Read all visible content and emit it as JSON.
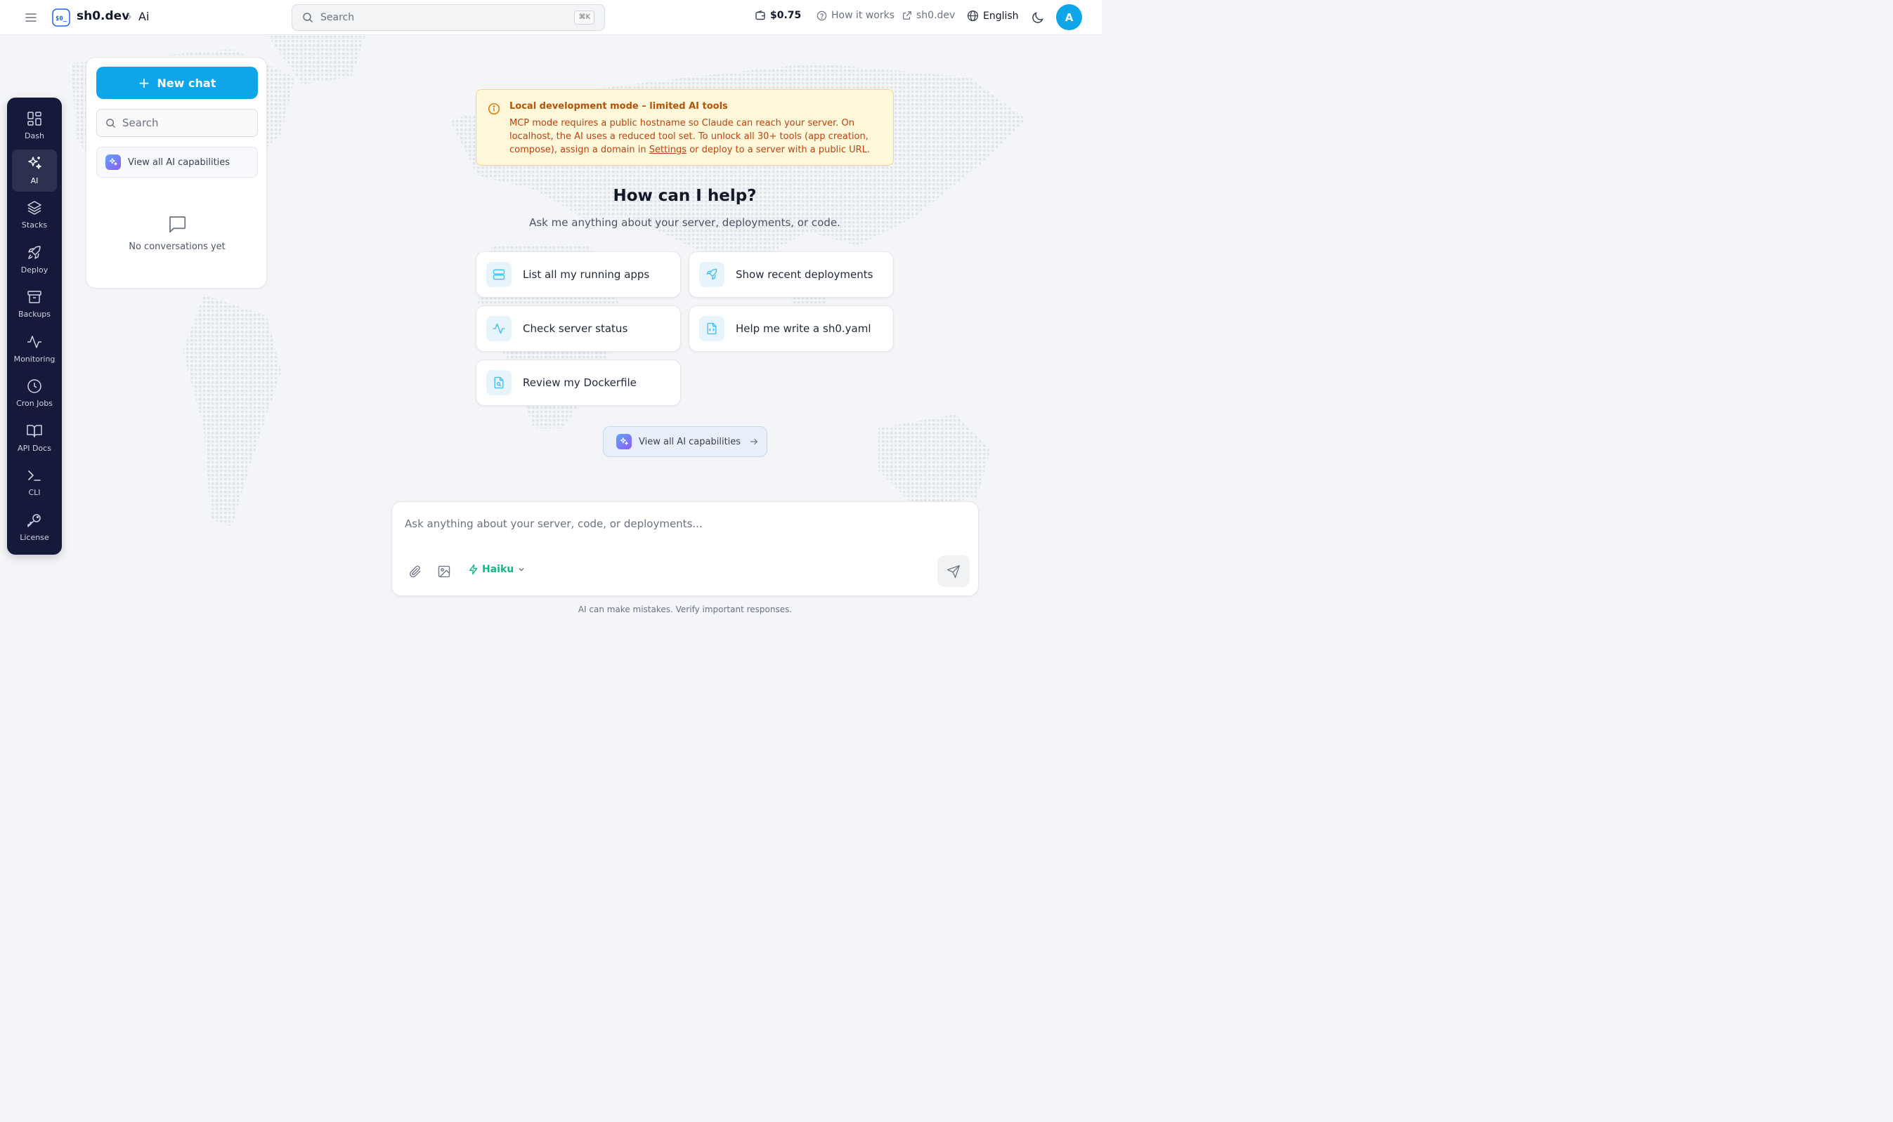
{
  "header": {
    "brand": "sh0.dev",
    "breadcrumb": "Ai",
    "search_placeholder": "Search",
    "search_shortcut": "⌘K",
    "credits": "$0.75",
    "how_it_works": "How it works",
    "external_link": "sh0.dev",
    "language": "English",
    "avatar_initial": "A"
  },
  "sidebar": {
    "items": [
      {
        "label": "Dash",
        "icon": "dashboard-icon"
      },
      {
        "label": "AI",
        "icon": "sparkles-icon",
        "active": true
      },
      {
        "label": "Stacks",
        "icon": "layers-icon"
      },
      {
        "label": "Deploy",
        "icon": "rocket-icon"
      },
      {
        "label": "Backups",
        "icon": "archive-icon"
      },
      {
        "label": "Monitoring",
        "icon": "activity-icon"
      },
      {
        "label": "Cron Jobs",
        "icon": "clock-icon"
      },
      {
        "label": "API Docs",
        "icon": "book-icon"
      },
      {
        "label": "CLI",
        "icon": "terminal-icon"
      },
      {
        "label": "License",
        "icon": "key-icon"
      }
    ]
  },
  "chat_panel": {
    "new_chat_label": "New chat",
    "search_placeholder": "Search",
    "capabilities_label": "View all AI capabilities",
    "empty_text": "No conversations yet"
  },
  "alert": {
    "title": "Local development mode – limited AI tools",
    "body_before_link": "MCP mode requires a public hostname so Claude can reach your server. On localhost, the AI uses a reduced tool set. To unlock all 30+ tools (app creation, compose), assign a domain in ",
    "link_text": "Settings",
    "body_after_link": " or deploy to a server with a public URL."
  },
  "hero": {
    "title": "How can I help?",
    "subtitle": "Ask me anything about your server, deployments, or code."
  },
  "suggestions": [
    {
      "label": "List all my running apps",
      "icon": "server-icon"
    },
    {
      "label": "Show recent deployments",
      "icon": "rocket-icon"
    },
    {
      "label": "Check server status",
      "icon": "activity-icon"
    },
    {
      "label": "Help me write a sh0.yaml",
      "icon": "file-code-icon"
    },
    {
      "label": "Review my Dockerfile",
      "icon": "file-search-icon"
    }
  ],
  "capabilities_button": "View all AI capabilities",
  "composer": {
    "placeholder": "Ask anything about your server, code, or deployments...",
    "model": "Haiku"
  },
  "disclaimer": "AI can make mistakes. Verify important responses.",
  "colors": {
    "accent": "#0ea5e9",
    "sidebar_bg": "#161a3a",
    "alert_bg": "#fff7da",
    "alert_text": "#c2410c",
    "model_green": "#10b981"
  }
}
